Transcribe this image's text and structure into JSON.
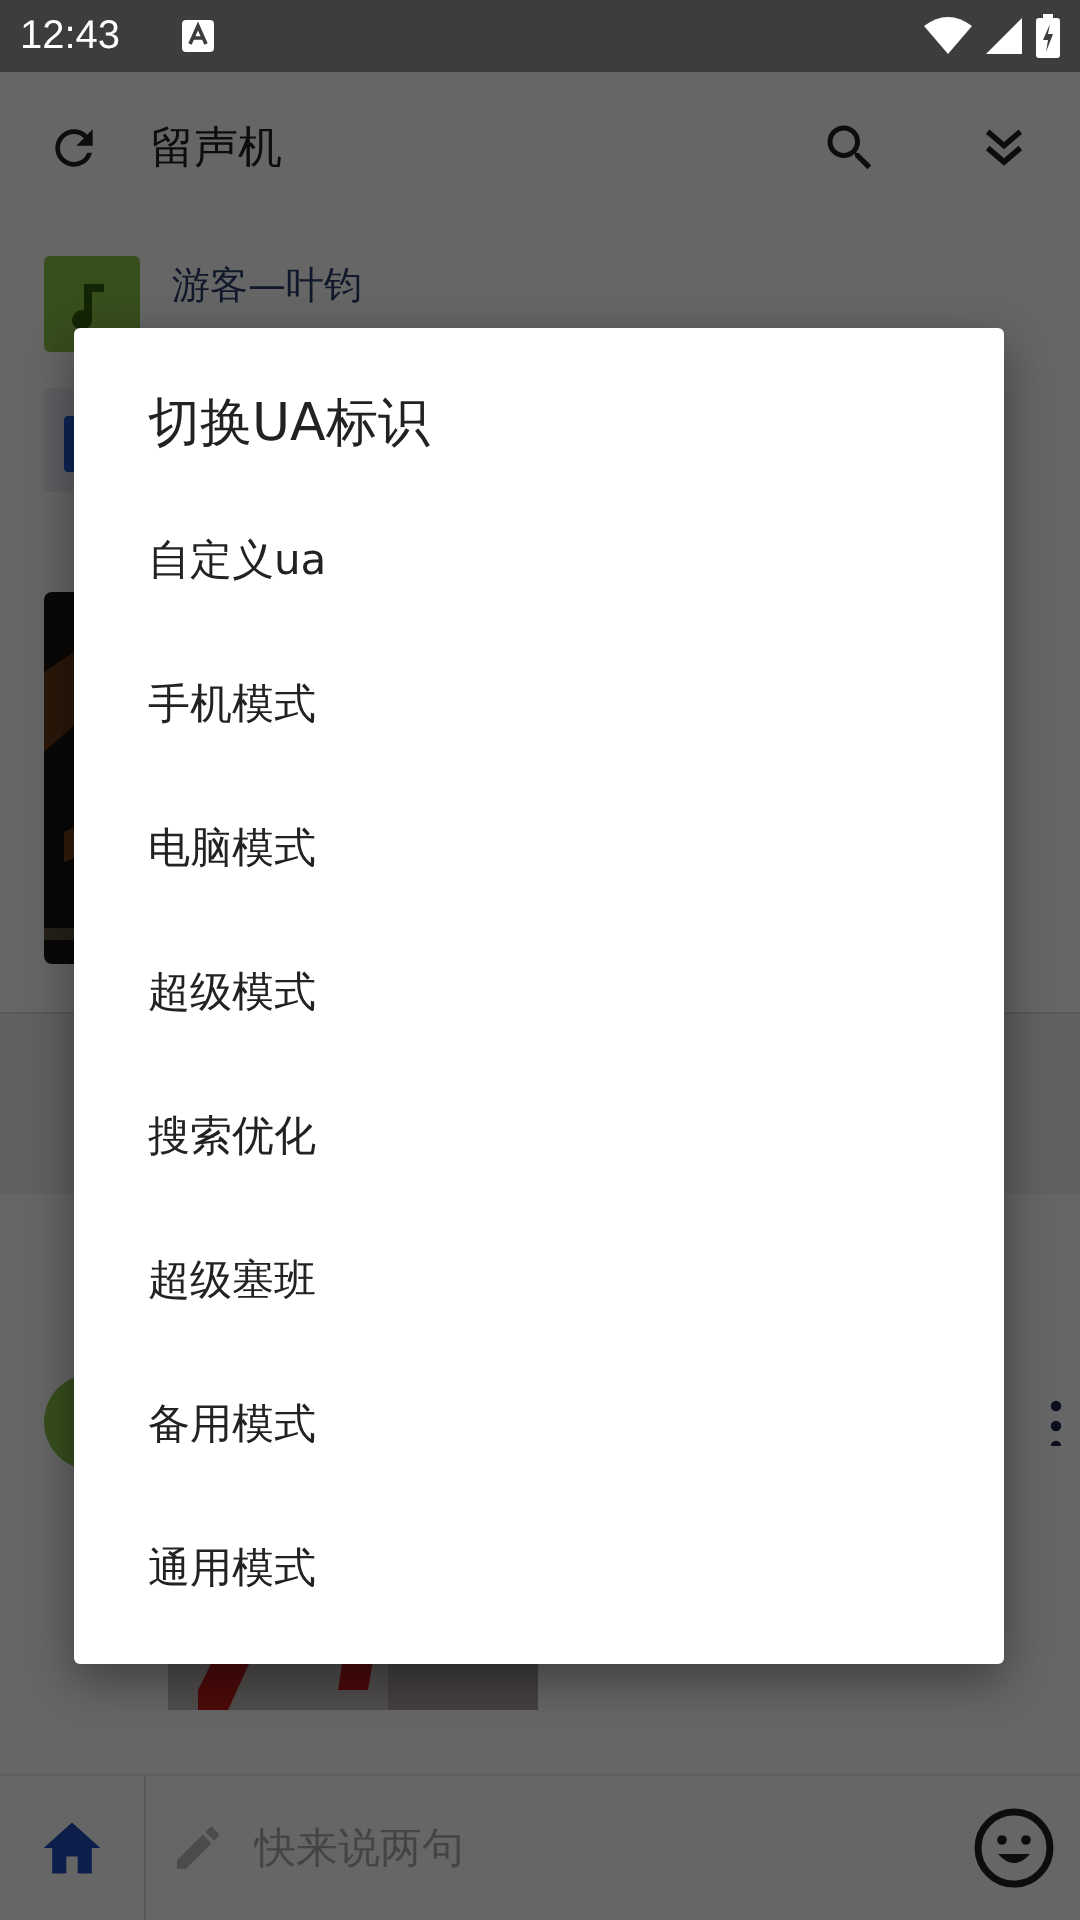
{
  "status_bar": {
    "time": "12:43"
  },
  "app_bar": {
    "title": "留声机"
  },
  "post": {
    "author": "游客—叶钧"
  },
  "dialog": {
    "title": "切换UA标识",
    "items": [
      {
        "label": "自定义ua"
      },
      {
        "label": "手机模式"
      },
      {
        "label": "电脑模式"
      },
      {
        "label": "超级模式"
      },
      {
        "label": "搜索优化"
      },
      {
        "label": "超级塞班"
      },
      {
        "label": "备用模式"
      },
      {
        "label": "通用模式"
      }
    ]
  },
  "comment_box": {
    "placeholder": "快来说两句"
  }
}
